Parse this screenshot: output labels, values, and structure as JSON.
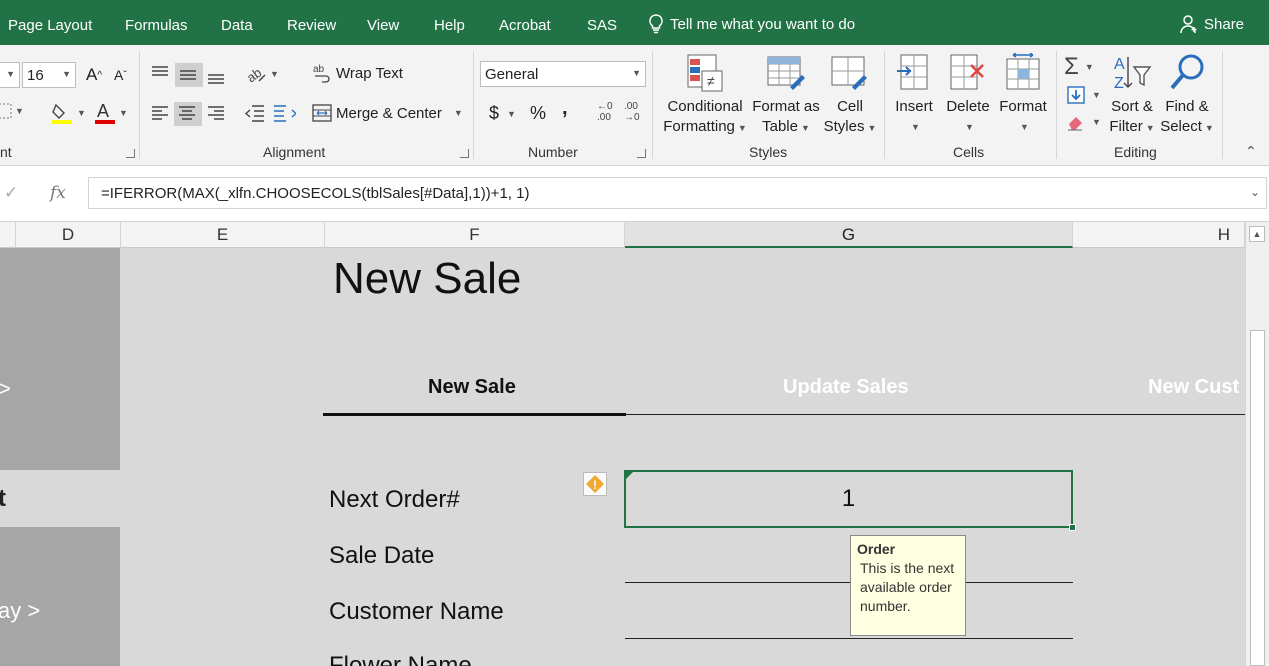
{
  "ribbon_tabs": [
    "Page Layout",
    "Formulas",
    "Data",
    "Review",
    "View",
    "Help",
    "Acrobat",
    "SAS"
  ],
  "tell_me": "Tell me what you want to do",
  "share": "Share",
  "font_group": {
    "size": "16",
    "label": "nt"
  },
  "alignment": {
    "wrap_text": "Wrap Text",
    "merge_center": "Merge & Center",
    "label": "Alignment"
  },
  "number": {
    "format": "General",
    "currency": "$",
    "percent": "%",
    "comma": ",",
    "label": "Number"
  },
  "styles": {
    "conditional_1": "Conditional",
    "conditional_2": "Formatting",
    "format_table_1": "Format as",
    "format_table_2": "Table",
    "cell_styles_1": "Cell",
    "cell_styles_2": "Styles",
    "label": "Styles"
  },
  "cells": {
    "insert": "Insert",
    "delete": "Delete",
    "format": "Format",
    "label": "Cells"
  },
  "editing": {
    "sort_1": "Sort &",
    "sort_2": "Filter",
    "find_1": "Find &",
    "find_2": "Select",
    "label": "Editing"
  },
  "formula_bar": {
    "fx": "fx",
    "formula": "=IFERROR(MAX(_xlfn.CHOOSECOLS(tblSales[#Data],1))+1, 1)"
  },
  "columns": [
    "D",
    "E",
    "F",
    "G",
    "H"
  ],
  "sheet": {
    "nav_items": [
      ">",
      "t",
      "ay >"
    ],
    "title": "New Sale",
    "tabs": {
      "new_sale": "New Sale",
      "update_sales": "Update Sales",
      "new_customer": "New Cust"
    },
    "fields": [
      "Next Order#",
      "Sale Date",
      "Customer Name",
      "Flower Name"
    ],
    "next_order_value": "1",
    "tooltip": {
      "title": "Order",
      "body": "This is the next available order number."
    }
  },
  "colors": {
    "ribbon_green": "#217346",
    "sheet_bg": "#d9d9d9",
    "nav_block": "#a6a6a6",
    "tooltip_bg": "#ffffe1"
  }
}
